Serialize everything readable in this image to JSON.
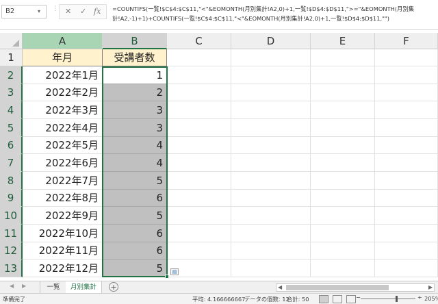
{
  "formula_bar": {
    "name_box": "B2",
    "name_box_arrow": "▾",
    "fx_sep": "⋮",
    "cancel_icon": "✕",
    "enter_icon": "✓",
    "fx_label": "fx",
    "formula_line1": "=COUNTIFS(一覧!$C$4:$C$11,\"<\"&EOMONTH(月別集計!A2,0)+1,一覧!$D$4:$D$11,\">=\"&EOMONTH(月別集",
    "formula_line2": "計!A2,-1)+1)+COUNTIFS(一覧!$C$4:$C$11,\"<\"&EOMONTH(月別集計!A2,0)+1,一覧!$D$4:$D$11,\"\")"
  },
  "columns": [
    "A",
    "B",
    "C",
    "D",
    "E",
    "F"
  ],
  "rows": [
    "1",
    "2",
    "3",
    "4",
    "5",
    "6",
    "7",
    "8",
    "9",
    "10",
    "11",
    "12",
    "13"
  ],
  "header_row": {
    "a": "年月",
    "b": "受講者数"
  },
  "data_rows": [
    {
      "month": "2022年1月",
      "count": "1"
    },
    {
      "month": "2022年2月",
      "count": "2"
    },
    {
      "month": "2022年3月",
      "count": "3"
    },
    {
      "month": "2022年4月",
      "count": "3"
    },
    {
      "month": "2022年5月",
      "count": "4"
    },
    {
      "month": "2022年6月",
      "count": "4"
    },
    {
      "month": "2022年7月",
      "count": "5"
    },
    {
      "month": "2022年8月",
      "count": "6"
    },
    {
      "month": "2022年9月",
      "count": "5"
    },
    {
      "month": "2022年10月",
      "count": "6"
    },
    {
      "month": "2022年11月",
      "count": "6"
    },
    {
      "month": "2022年12月",
      "count": "5"
    }
  ],
  "paste_icon": "▤",
  "sheet_tabs": {
    "prev_icon": "◀",
    "next_icon": "▶",
    "tabs": [
      "一覧",
      "月別集計"
    ],
    "add_icon": "+",
    "scroll_left_icon": "◀",
    "scroll_right_icon": "▶"
  },
  "status_bar": {
    "ready": "準備完了",
    "average": "平均: 4.166666667",
    "count": "データの個数: 12",
    "sum": "合計: 50",
    "zoom_minus": "−",
    "zoom_plus": "+",
    "zoom": "205%"
  },
  "colors": {
    "accent": "#217346",
    "header_fill": "#fff2cc",
    "column_a_header_fill": "#a9d5b5",
    "selection_fill": "#c0c0c0"
  }
}
